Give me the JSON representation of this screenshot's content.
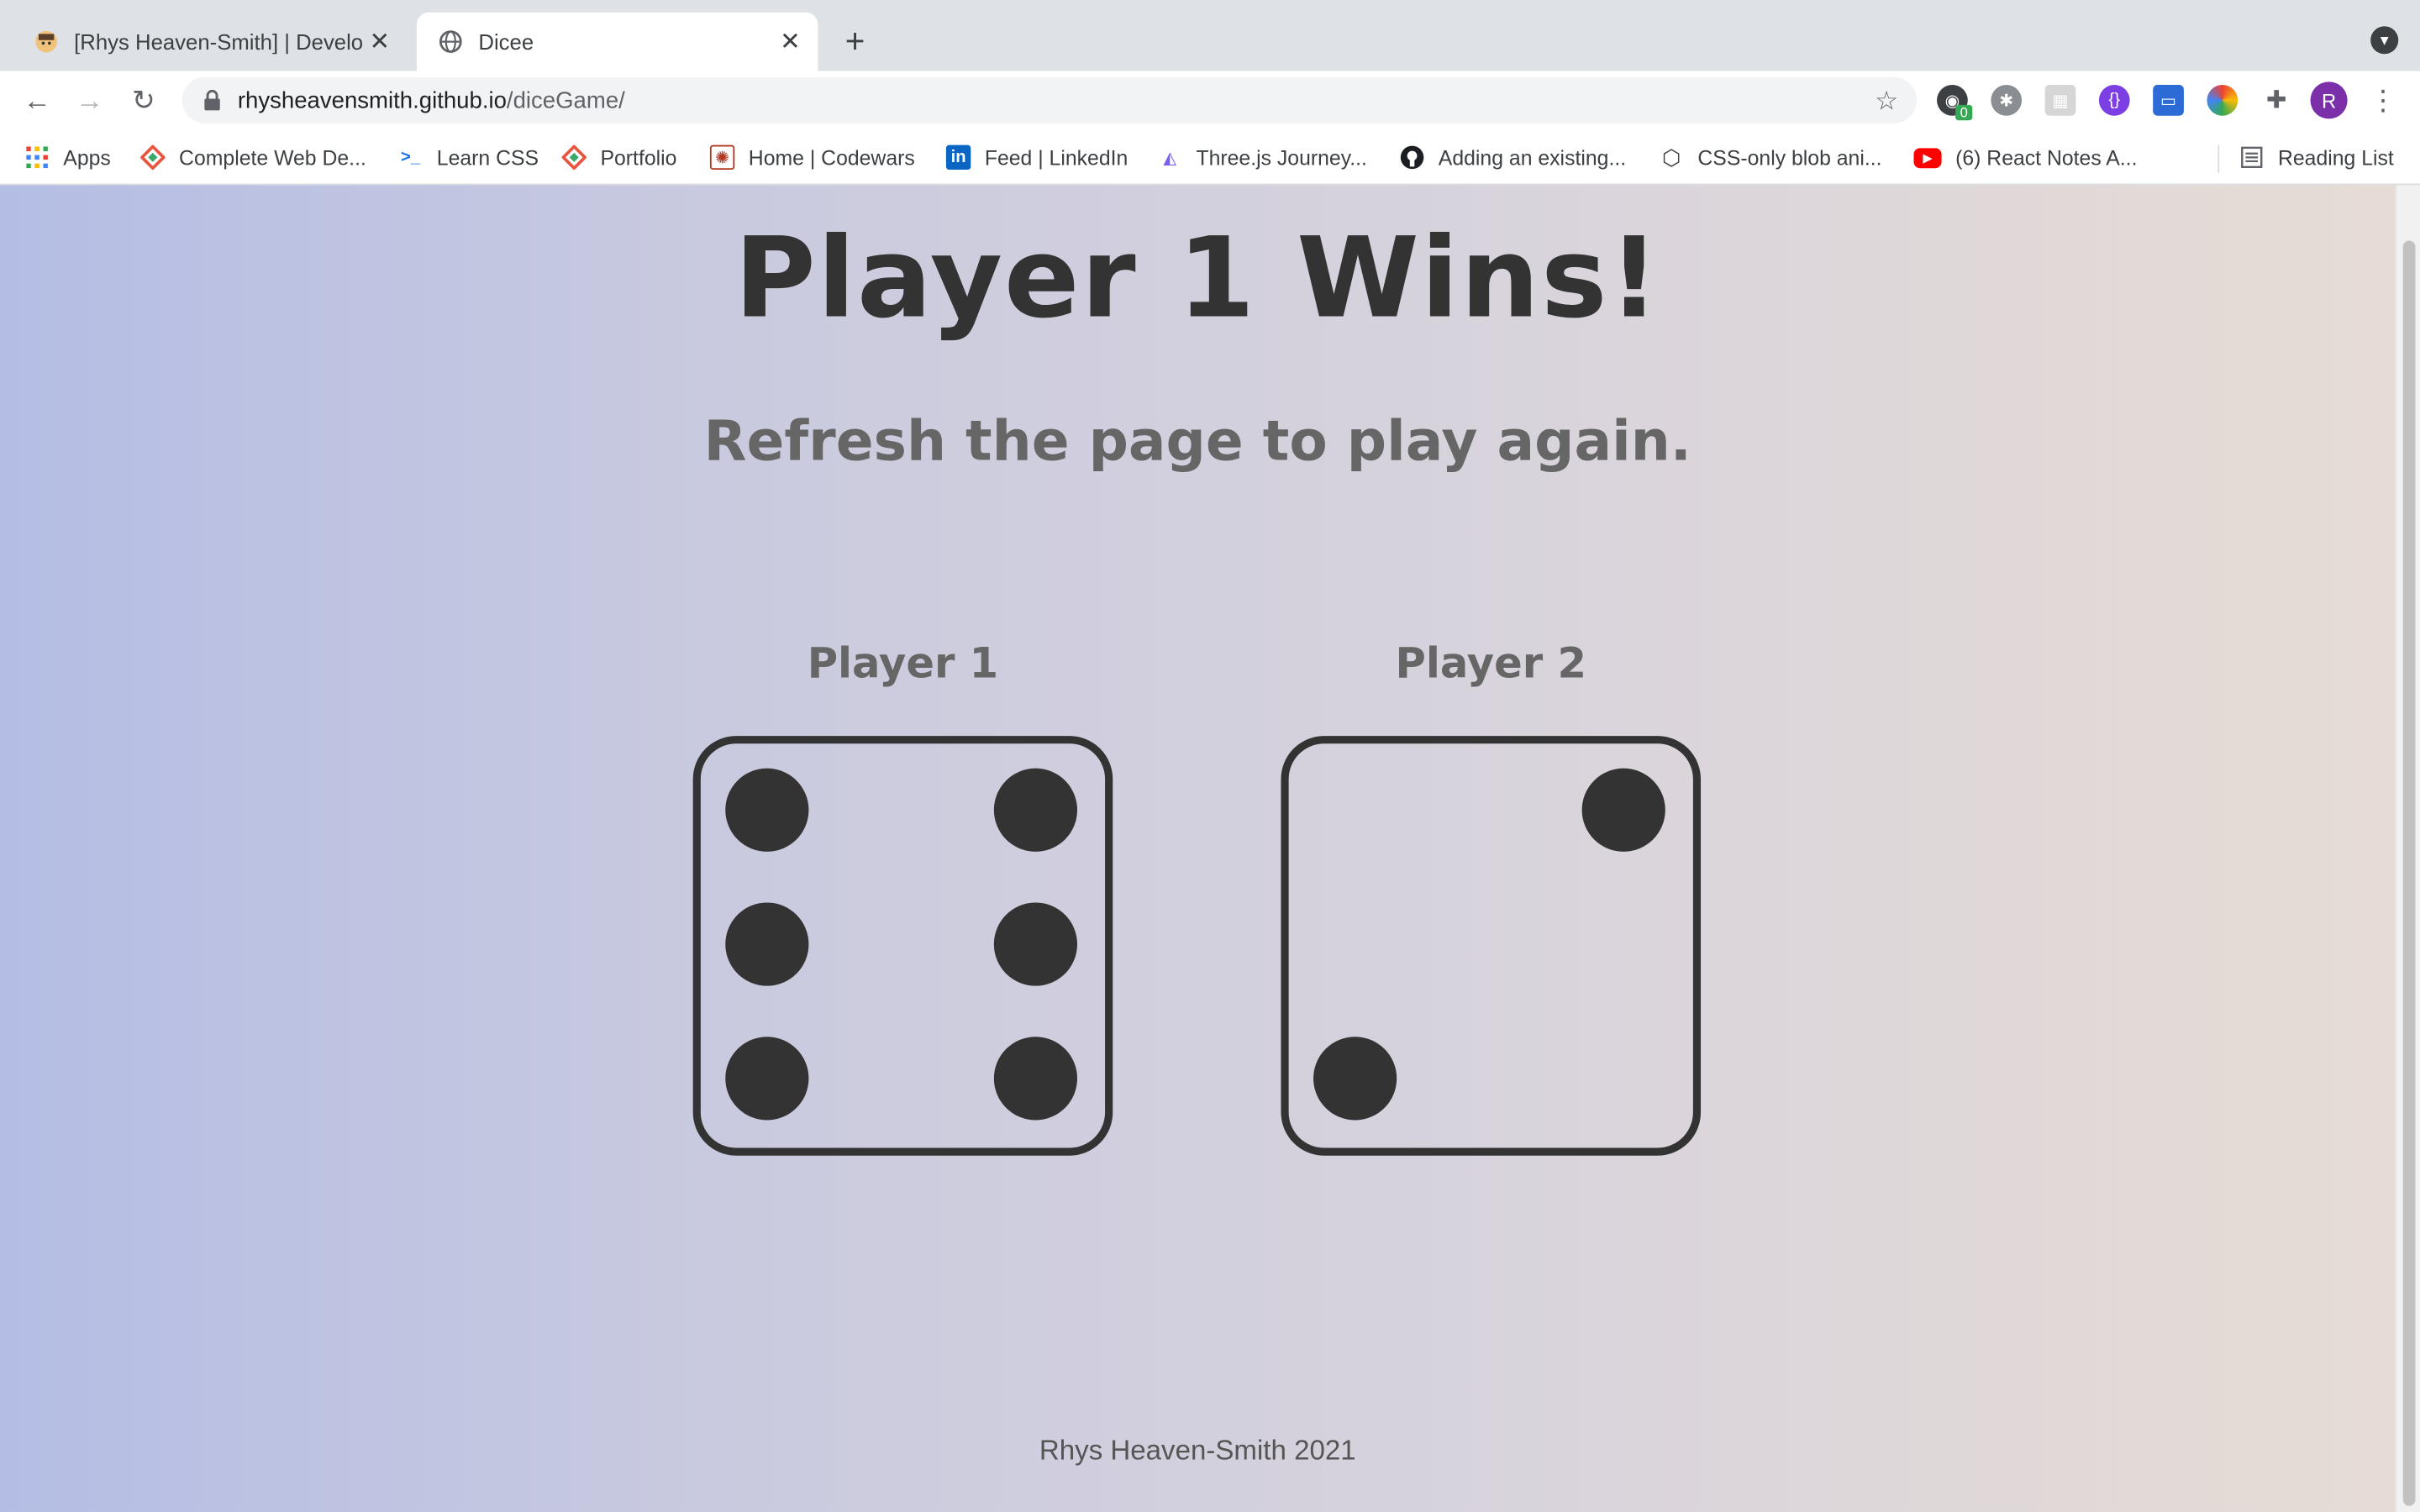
{
  "browser": {
    "tabs": [
      {
        "title": "[Rhys Heaven-Smith] | Develop",
        "active": false,
        "favicon": "avatar-emoji-icon"
      },
      {
        "title": "Dicee",
        "active": true,
        "favicon": "globe-icon"
      }
    ],
    "url_host": "rhysheavensmith.github.io",
    "url_path": "/diceGame/",
    "extension_badge": "0",
    "profile_initial": "R",
    "bookmarks": [
      {
        "label": "Apps",
        "icon": "apps-grid-icon"
      },
      {
        "label": "Complete Web De...",
        "icon": "course-logo-icon"
      },
      {
        "label": "Learn CSS",
        "icon": "learn-css-icon"
      },
      {
        "label": "Portfolio",
        "icon": "portfolio-logo-icon"
      },
      {
        "label": "Home | Codewars",
        "icon": "codewars-icon"
      },
      {
        "label": "Feed | LinkedIn",
        "icon": "linkedin-icon"
      },
      {
        "label": "Three.js Journey...",
        "icon": "threejs-icon"
      },
      {
        "label": "Adding an existing...",
        "icon": "github-icon"
      },
      {
        "label": "CSS-only blob ani...",
        "icon": "codepen-icon"
      },
      {
        "label": "(6) React Notes A...",
        "icon": "youtube-icon"
      }
    ],
    "reading_list": "Reading List"
  },
  "game": {
    "headline": "Player 1 Wins!",
    "subline": "Refresh the page to play again.",
    "players": [
      {
        "label": "Player 1",
        "die_value": 6
      },
      {
        "label": "Player 2",
        "die_value": 2
      }
    ]
  },
  "footer": "Rhys Heaven-Smith 2021",
  "colors": {
    "text_dark": "#333333",
    "text_mid": "#666666",
    "gradient_left": "#b4bde4",
    "gradient_right": "#e6dcd5"
  }
}
